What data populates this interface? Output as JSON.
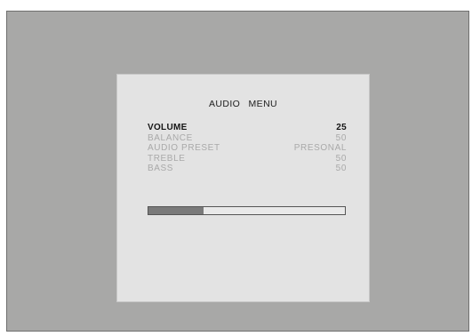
{
  "heading_fragment": {
    "left_text": "",
    "right_text": ""
  },
  "osd": {
    "title": "AUDIO MENU",
    "items": [
      {
        "label": "VOLUME",
        "value": "25",
        "selected": true
      },
      {
        "label": "BALANCE",
        "value": "50",
        "selected": false
      },
      {
        "label": "AUDIO PRESET",
        "value": "PRESONAL",
        "selected": false
      },
      {
        "label": "TREBLE",
        "value": "50",
        "selected": false
      },
      {
        "label": "BASS",
        "value": "50",
        "selected": false
      }
    ],
    "level_bar": {
      "fraction": 0.28
    }
  },
  "colors": {
    "outer_background": "#a8a8a7",
    "panel_background": "#e3e3e3",
    "selected_text": "#151515",
    "inactive_text": "#a9a9a9",
    "bar_fill": "#7a7a7a"
  }
}
